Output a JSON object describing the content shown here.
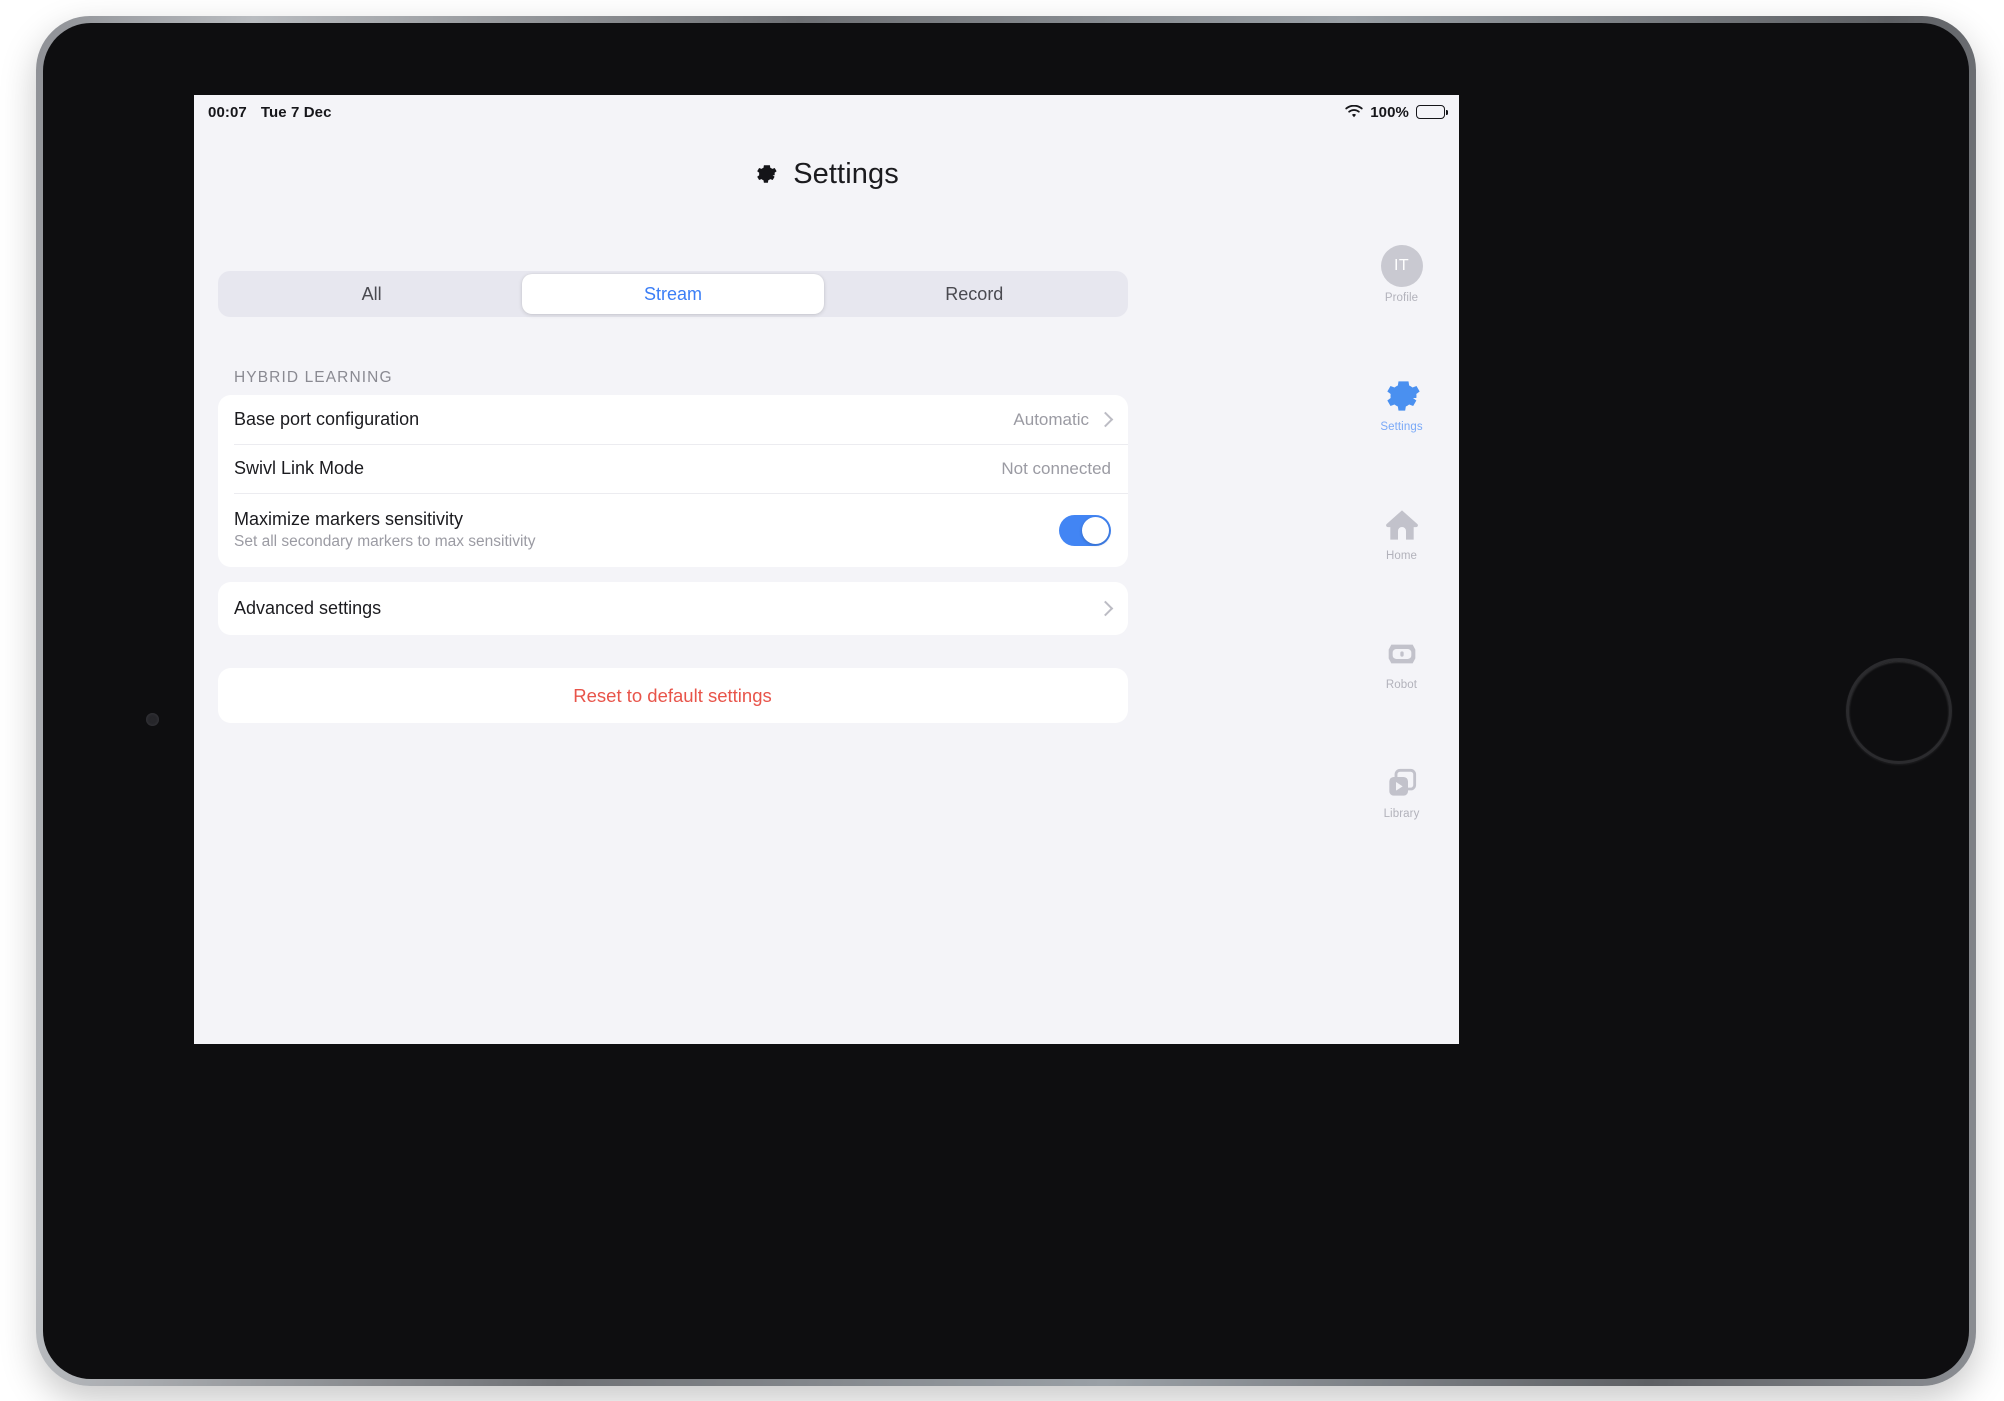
{
  "status_bar": {
    "time": "00:07",
    "date": "Tue 7 Dec",
    "battery_percent": "100%",
    "wifi_icon": "wifi-icon",
    "battery_icon": "battery-full-icon"
  },
  "header": {
    "title": "Settings",
    "icon": "gear-icon"
  },
  "segmented_control": {
    "options": [
      {
        "label": "All",
        "active": false
      },
      {
        "label": "Stream",
        "active": true
      },
      {
        "label": "Record",
        "active": false
      }
    ],
    "selected": "Stream",
    "active_color": "#3b7ef6"
  },
  "sections": [
    {
      "header": "HYBRID LEARNING",
      "rows": [
        {
          "title": "Base port configuration",
          "value": "Automatic",
          "accessory": "chevron-right-icon"
        },
        {
          "title": "Swivl Link Mode",
          "value": "Not connected",
          "accessory": "none"
        },
        {
          "title": "Maximize markers sensitivity",
          "subtitle": "Set all secondary markers to max sensitivity",
          "accessory": "toggle",
          "toggle_on": true,
          "toggle_color": "#4285f4"
        }
      ]
    }
  ],
  "advanced_row": {
    "title": "Advanced settings",
    "accessory": "chevron-right-icon"
  },
  "reset_button": {
    "label": "Reset to default settings",
    "color": "#e8544a"
  },
  "right_rail": {
    "items": [
      {
        "label": "Profile",
        "icon": "avatar-icon",
        "initials": "IT",
        "active": false
      },
      {
        "label": "Settings",
        "icon": "gear-icon",
        "active": true
      },
      {
        "label": "Home",
        "icon": "home-icon",
        "active": false
      },
      {
        "label": "Robot",
        "icon": "robot-icon",
        "active": false
      },
      {
        "label": "Library",
        "icon": "library-play-icon",
        "active": false
      }
    ]
  },
  "device": {
    "front_camera": "front-camera",
    "home_button": "home-button"
  }
}
